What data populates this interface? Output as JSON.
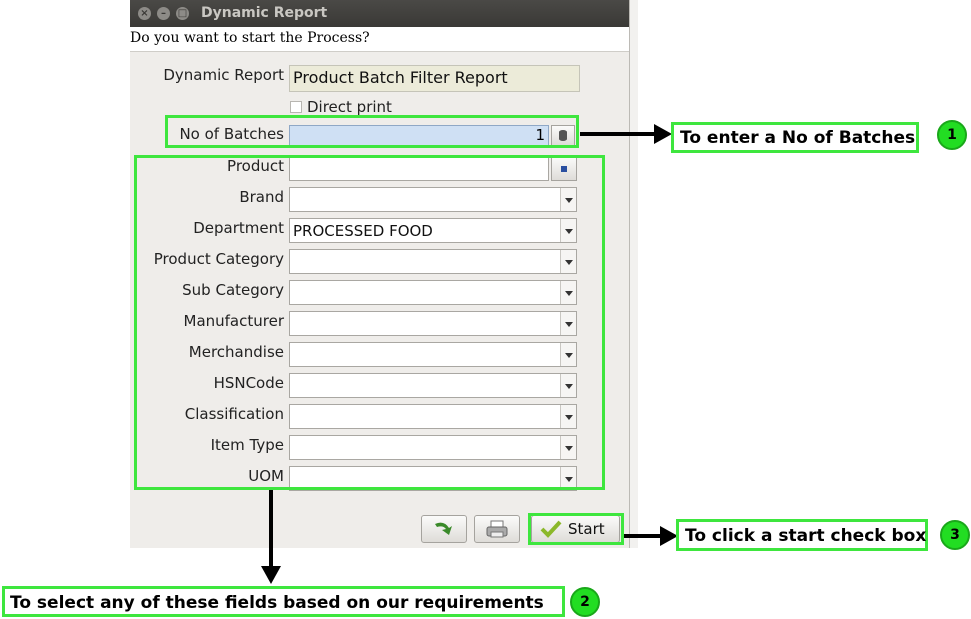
{
  "window": {
    "title": "Dynamic Report",
    "prompt": "Do you want to start the Process?"
  },
  "form": {
    "dynamic_report_label": "Dynamic Report",
    "dynamic_report_value": "Product Batch Filter Report",
    "direct_print_label": "Direct print",
    "no_of_batches_label": "No of Batches",
    "no_of_batches_value": "1",
    "fields": [
      {
        "label": "Product",
        "value": ""
      },
      {
        "label": "Brand",
        "value": ""
      },
      {
        "label": "Department",
        "value": "PROCESSED FOOD"
      },
      {
        "label": "Product Category",
        "value": ""
      },
      {
        "label": "Sub Category",
        "value": ""
      },
      {
        "label": "Manufacturer",
        "value": ""
      },
      {
        "label": "Merchandise",
        "value": ""
      },
      {
        "label": "HSNCode",
        "value": ""
      },
      {
        "label": "Classification",
        "value": ""
      },
      {
        "label": "Item Type",
        "value": ""
      },
      {
        "label": "UOM",
        "value": ""
      }
    ]
  },
  "buttons": {
    "start_label": "Start"
  },
  "annotations": {
    "callout1": "To enter a No of Batches",
    "callout2": "To select any of these fields based on our requirements",
    "callout3": "To click a start check box",
    "num1": "1",
    "num2": "2",
    "num3": "3"
  },
  "colors": {
    "highlight": "#3ee63e",
    "badge": "#22dd22"
  }
}
